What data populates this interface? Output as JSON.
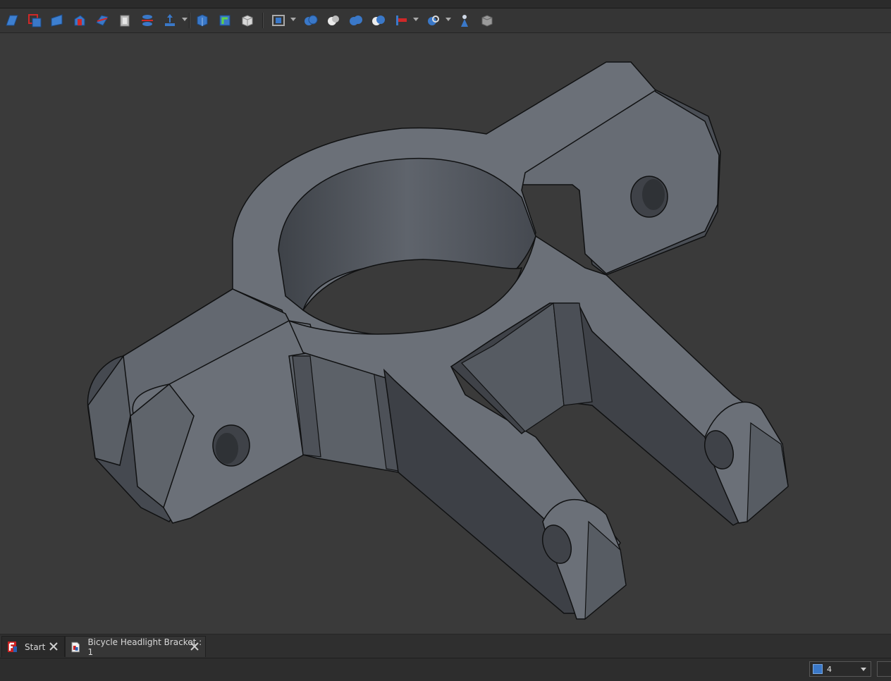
{
  "toolbar": {
    "tools": [
      {
        "icon": "pad-icon"
      },
      {
        "icon": "pocket-icon"
      },
      {
        "icon": "revolution-icon"
      },
      {
        "icon": "groove-icon"
      },
      {
        "icon": "loft-icon"
      },
      {
        "icon": "thickness-icon"
      },
      {
        "icon": "mirror-icon"
      },
      {
        "icon": "extrude-icon"
      },
      {
        "icon": "shell-icon"
      },
      {
        "icon": "fillet-icon"
      },
      {
        "icon": "box-icon"
      },
      {
        "icon": "compound-icon"
      },
      {
        "icon": "boolean-icon"
      },
      {
        "icon": "cut-icon"
      },
      {
        "icon": "fuse-icon"
      },
      {
        "icon": "common-icon"
      },
      {
        "icon": "join-icon"
      },
      {
        "icon": "split-icon"
      },
      {
        "icon": "check-geometry-icon"
      },
      {
        "icon": "defeaturing-icon"
      }
    ]
  },
  "tabs": [
    {
      "label": "Start",
      "icon": "freecad-logo-icon",
      "active": false
    },
    {
      "label": "Bicycle Headlight Bracket : 1",
      "icon": "document-icon",
      "active": true
    }
  ],
  "status": {
    "navigation_value": "4"
  },
  "colors": {
    "background": "#3a3a3a",
    "model_top": "#6b7078",
    "model_side": "#4a4e55",
    "model_dark": "#3d4046",
    "accent_blue": "#3a78c8",
    "accent_red": "#d02828"
  }
}
